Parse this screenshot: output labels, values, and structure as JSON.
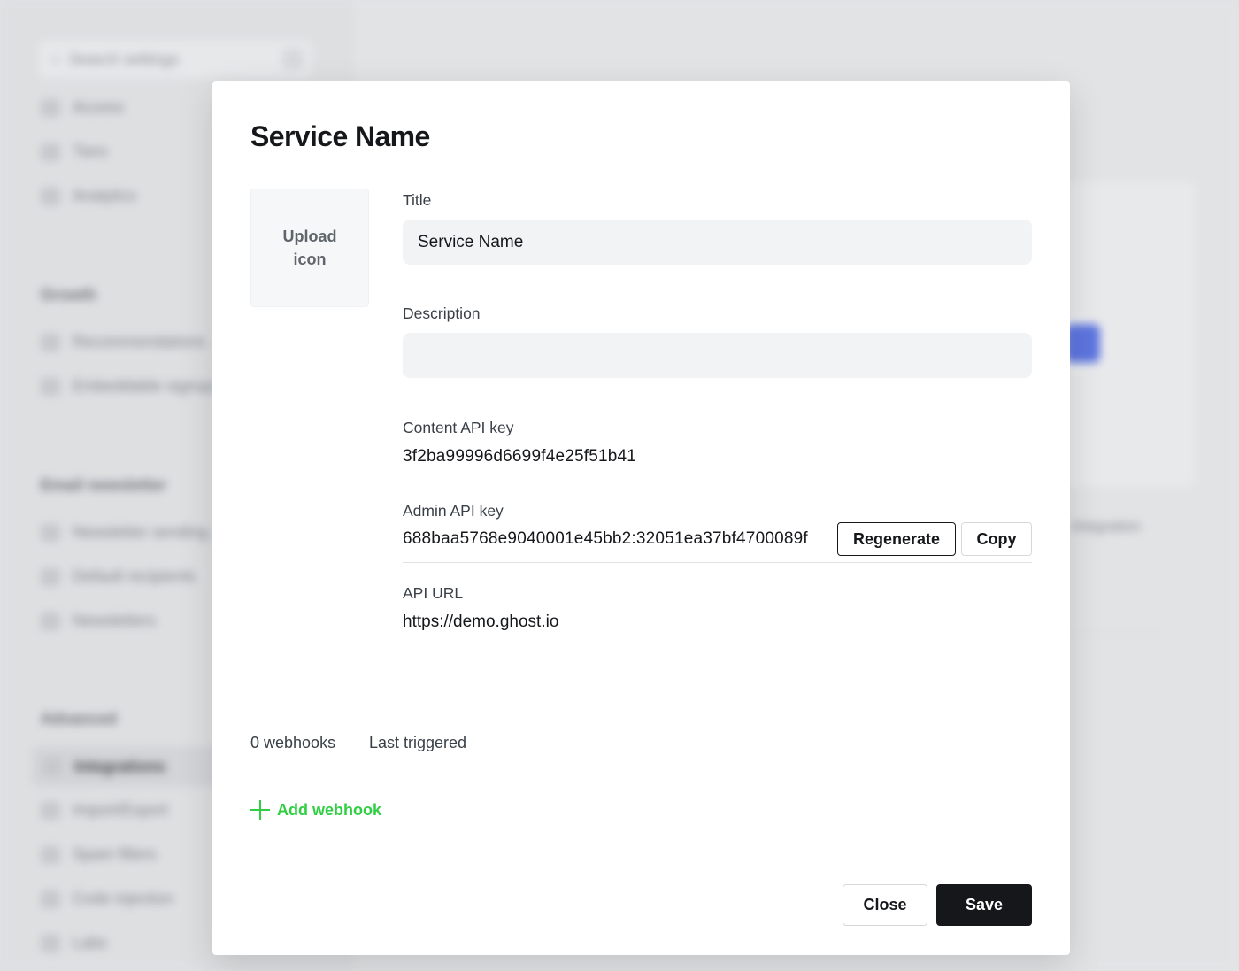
{
  "background": {
    "search_placeholder": "Search settings",
    "items_top": [
      "Access",
      "Tiers",
      "Analytics"
    ],
    "group_growth": "Growth",
    "items_growth": [
      "Recommendations",
      "Embeddable signup form"
    ],
    "group_email": "Email newsletter",
    "items_email": [
      "Newsletter sending",
      "Default recipients",
      "Newsletters"
    ],
    "group_advanced": "Advanced",
    "items_advanced": [
      "Integrations",
      "Import/Export",
      "Spam filters",
      "Code injection",
      "Labs"
    ],
    "right_text": "integration"
  },
  "modal": {
    "title": "Service Name",
    "upload_label": "Upload icon",
    "title_label": "Title",
    "title_value": "Service Name",
    "description_label": "Description",
    "description_value": "",
    "content_key_label": "Content API key",
    "content_key_value": "3f2ba99996d6699f4e25f51b41",
    "admin_key_label": "Admin API key",
    "admin_key_value": "688baa5768e9040001e45bb2:32051ea37bf4700089f",
    "regenerate_label": "Regenerate",
    "copy_label": "Copy",
    "api_url_label": "API URL",
    "api_url_value": "https://demo.ghost.io",
    "webhooks_count": "0 webhooks",
    "last_triggered": "Last triggered",
    "add_webhook_label": "Add webhook",
    "close_label": "Close",
    "save_label": "Save"
  },
  "colors": {
    "accent_green": "#30cf43",
    "primary_dark": "#15171a"
  }
}
